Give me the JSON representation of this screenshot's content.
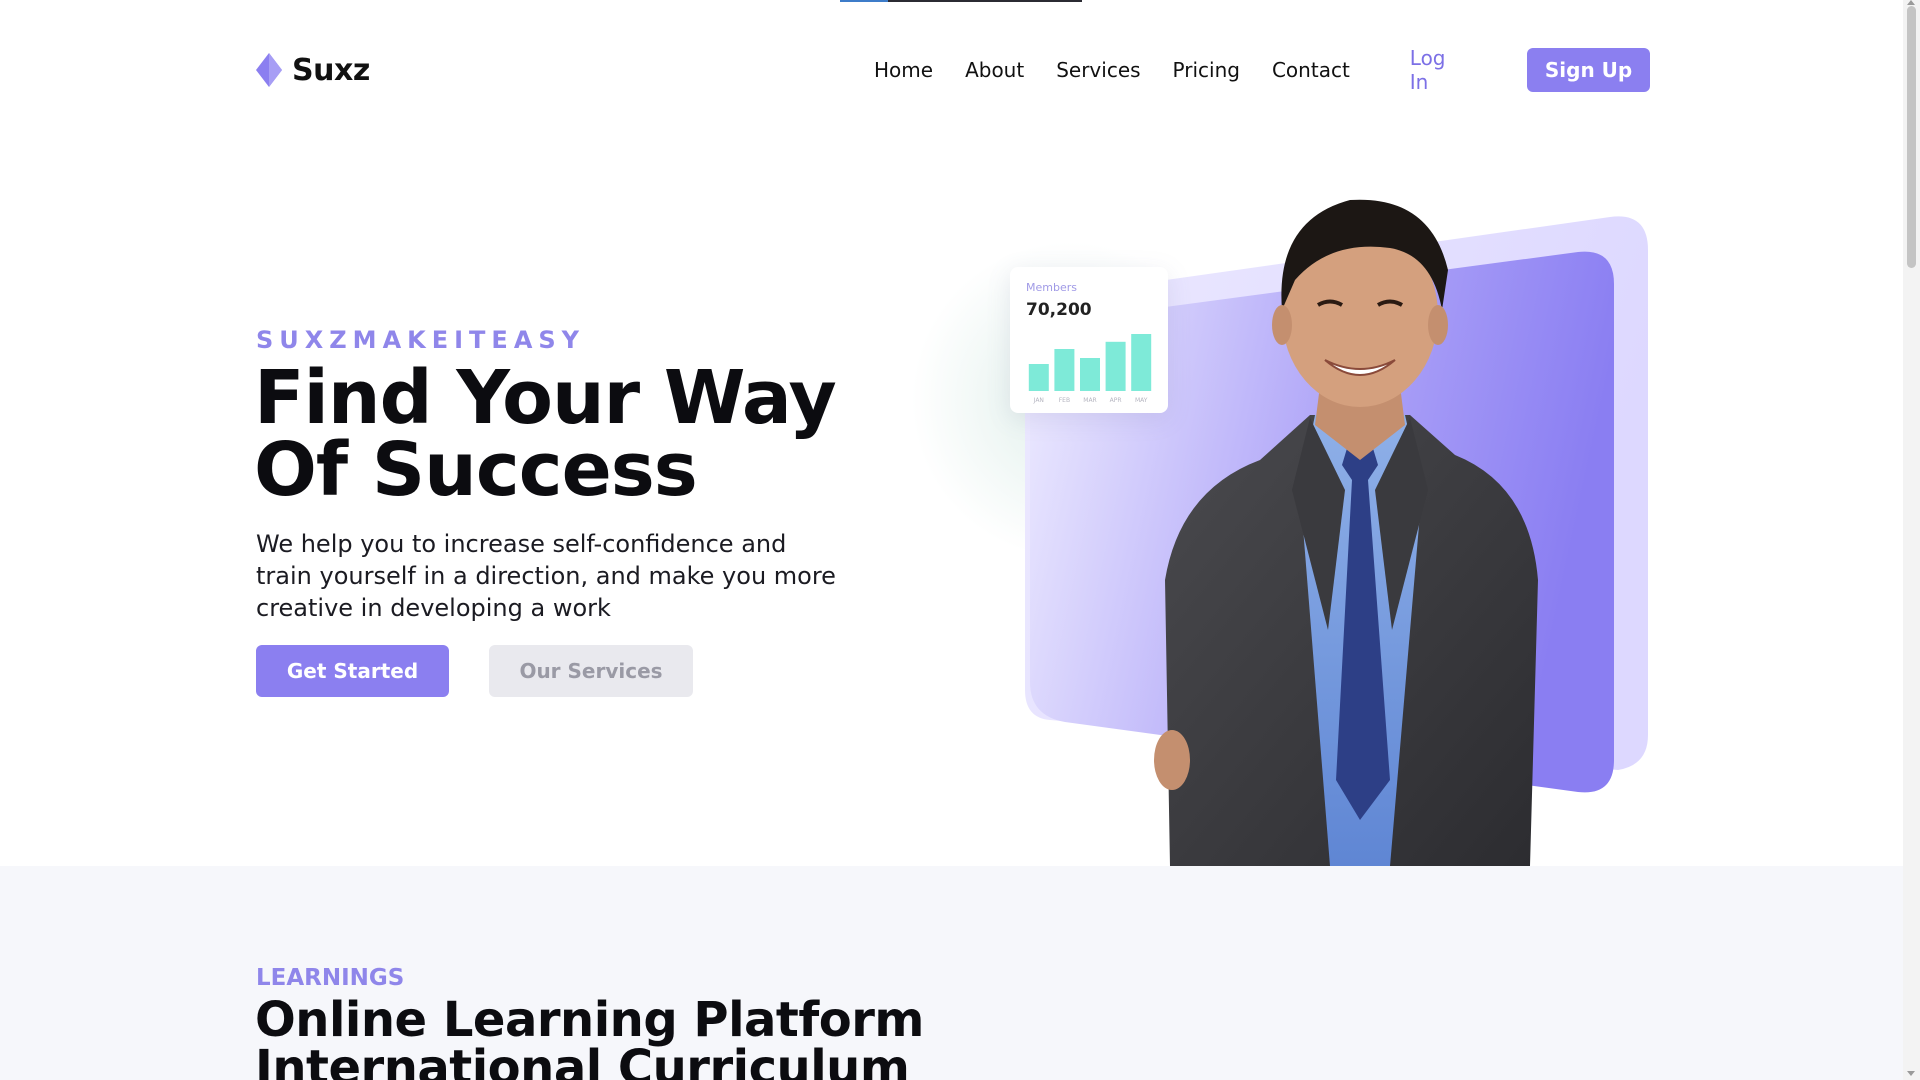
{
  "header": {
    "brand": "Suxz",
    "nav": [
      {
        "label": "Home"
      },
      {
        "label": "About"
      },
      {
        "label": "Services"
      },
      {
        "label": "Pricing"
      },
      {
        "label": "Contact"
      }
    ],
    "login_label": "Log In",
    "signup_label": "Sign Up"
  },
  "hero": {
    "eyebrow": "SUXZMAKEITEASY",
    "title_line1": "Find Your Way",
    "title_line2": "Of Success",
    "subtitle": "We help you to increase self-confidence and train yourself in a direction, and make you more creative in developing a work",
    "primary_cta": "Get Started",
    "secondary_cta": "Our Services"
  },
  "stats_card": {
    "label": "Members",
    "value": "70,200",
    "months": [
      "JAN",
      "FEB",
      "MAR",
      "APR",
      "MAY"
    ],
    "bars": [
      0.45,
      0.7,
      0.55,
      0.82,
      0.95
    ]
  },
  "learnings": {
    "eyebrow": "LEARNINGS",
    "title_line1": "Online Learning Platform",
    "title_line2": "International Curriculum"
  },
  "colors": {
    "accent": "#8b7ff0",
    "accent_light": "#ebe8ff",
    "bar": "#7eead8",
    "section_bg": "#f6f7fb"
  }
}
